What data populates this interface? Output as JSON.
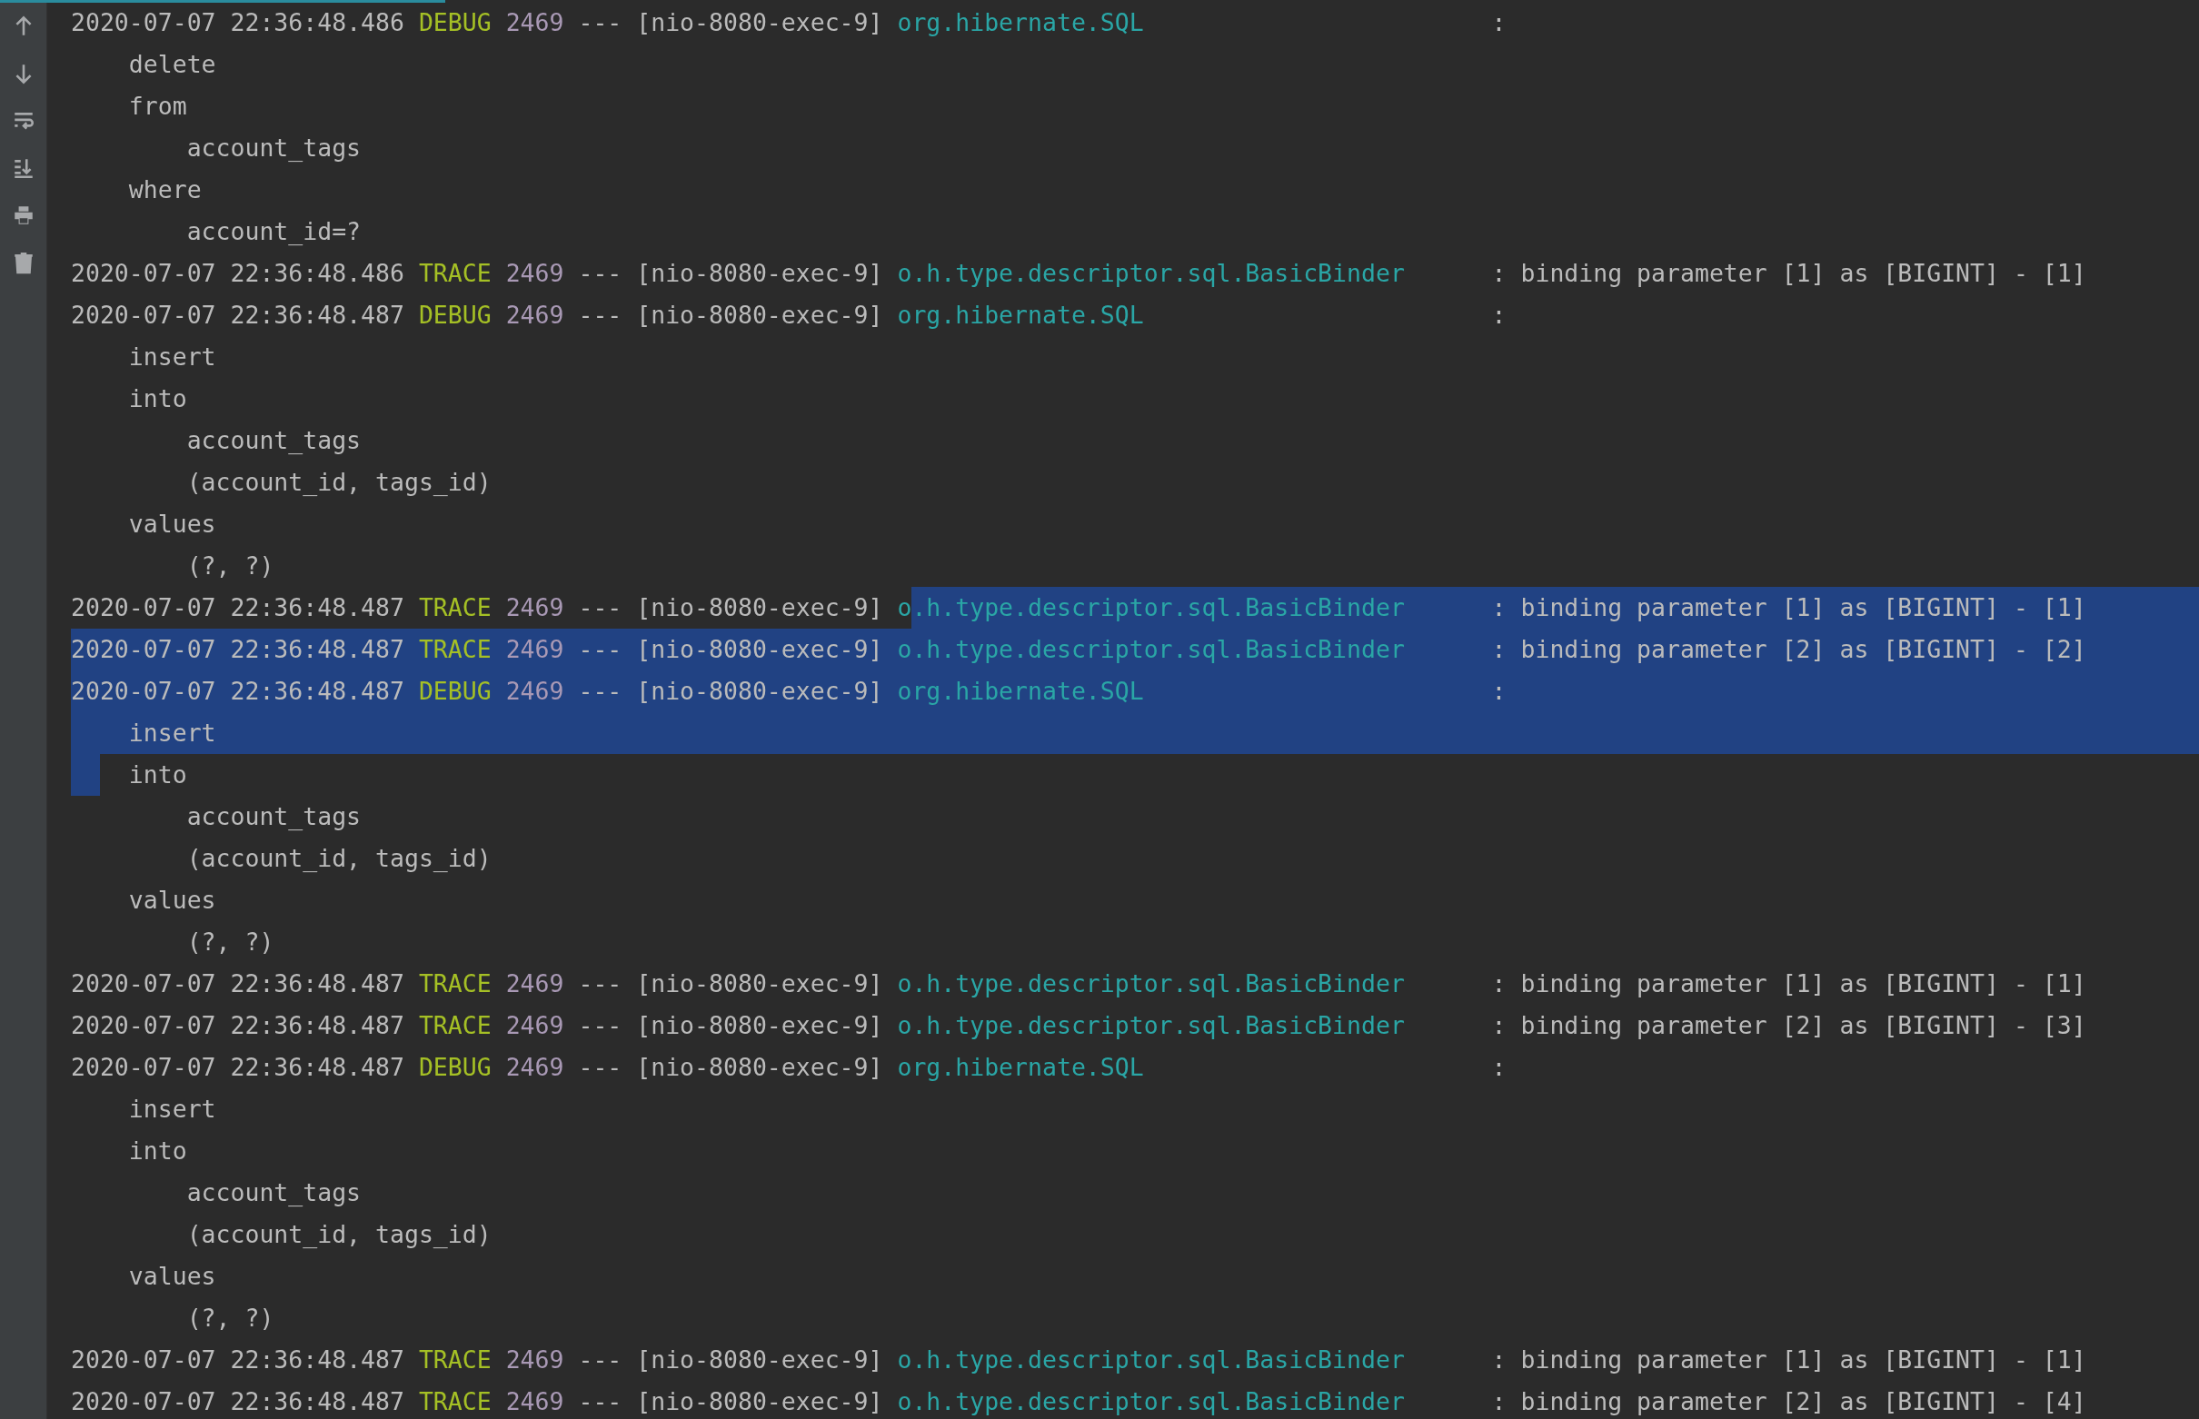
{
  "toolbar": {
    "buttons": [
      {
        "kind": "up"
      },
      {
        "kind": "down"
      },
      {
        "kind": "wrap"
      },
      {
        "kind": "scroll_end"
      },
      {
        "kind": "print"
      },
      {
        "kind": "trash"
      }
    ]
  },
  "lines": [
    {
      "kind": "log",
      "timestamp": "2020-07-07 22:36:48.486",
      "level": "DEBUG",
      "pid": "2469",
      "separator": "---",
      "thread": "[nio-8080-exec-9]",
      "logger": "org.hibernate.SQL",
      "message": ":",
      "selected": false,
      "selection_start": false,
      "selection_end": false
    },
    {
      "kind": "clause",
      "text": "delete",
      "selected": false,
      "selection_start": false,
      "selection_end": false
    },
    {
      "kind": "clause",
      "text": "from",
      "selected": false,
      "selection_start": false,
      "selection_end": false
    },
    {
      "kind": "arg",
      "text": "account_tags",
      "selected": false,
      "selection_start": false,
      "selection_end": false
    },
    {
      "kind": "clause",
      "text": "where",
      "selected": false,
      "selection_start": false,
      "selection_end": false
    },
    {
      "kind": "arg",
      "text": "account_id=?",
      "selected": false,
      "selection_start": false,
      "selection_end": false
    },
    {
      "kind": "log",
      "timestamp": "2020-07-07 22:36:48.486",
      "level": "TRACE",
      "pid": "2469",
      "separator": "---",
      "thread": "[nio-8080-exec-9]",
      "logger": "o.h.type.descriptor.sql.BasicBinder",
      "message": ": binding parameter [1] as [BIGINT] - [1]",
      "selected": false,
      "selection_start": false,
      "selection_end": false
    },
    {
      "kind": "log",
      "timestamp": "2020-07-07 22:36:48.487",
      "level": "DEBUG",
      "pid": "2469",
      "separator": "---",
      "thread": "[nio-8080-exec-9]",
      "logger": "org.hibernate.SQL",
      "message": ":",
      "selected": false,
      "selection_start": false,
      "selection_end": false
    },
    {
      "kind": "clause",
      "text": "insert",
      "selected": false,
      "selection_start": false,
      "selection_end": false
    },
    {
      "kind": "clause",
      "text": "into",
      "selected": false,
      "selection_start": false,
      "selection_end": false
    },
    {
      "kind": "arg",
      "text": "account_tags",
      "selected": false,
      "selection_start": false,
      "selection_end": false
    },
    {
      "kind": "arg",
      "text": "(account_id, tags_id)",
      "selected": false,
      "selection_start": false,
      "selection_end": false
    },
    {
      "kind": "clause",
      "text": "values",
      "selected": false,
      "selection_start": false,
      "selection_end": false
    },
    {
      "kind": "arg",
      "text": "(?, ?)",
      "selected": false,
      "selection_start": false,
      "selection_end": false
    },
    {
      "kind": "log",
      "timestamp": "2020-07-07 22:36:48.487",
      "level": "TRACE",
      "pid": "2469",
      "separator": "---",
      "thread": "[nio-8080-exec-9]",
      "logger": "o.h.type.descriptor.sql.BasicBinder",
      "message": ": binding parameter [1] as [BIGINT] - [1]",
      "selected": false,
      "selection_start": true,
      "selection_end": false
    },
    {
      "kind": "log",
      "timestamp": "2020-07-07 22:36:48.487",
      "level": "TRACE",
      "pid": "2469",
      "separator": "---",
      "thread": "[nio-8080-exec-9]",
      "logger": "o.h.type.descriptor.sql.BasicBinder",
      "message": ": binding parameter [2] as [BIGINT] - [2]",
      "selected": true,
      "selection_start": false,
      "selection_end": false
    },
    {
      "kind": "log",
      "timestamp": "2020-07-07 22:36:48.487",
      "level": "DEBUG",
      "pid": "2469",
      "separator": "---",
      "thread": "[nio-8080-exec-9]",
      "logger": "org.hibernate.SQL",
      "message": ":",
      "selected": true,
      "selection_start": false,
      "selection_end": false
    },
    {
      "kind": "clause",
      "text": "insert",
      "selected": true,
      "selection_start": false,
      "selection_end": false
    },
    {
      "kind": "clause",
      "text": "into",
      "selected": false,
      "selection_start": false,
      "selection_end": true
    },
    {
      "kind": "arg",
      "text": "account_tags",
      "selected": false,
      "selection_start": false,
      "selection_end": false
    },
    {
      "kind": "arg",
      "text": "(account_id, tags_id)",
      "selected": false,
      "selection_start": false,
      "selection_end": false
    },
    {
      "kind": "clause",
      "text": "values",
      "selected": false,
      "selection_start": false,
      "selection_end": false
    },
    {
      "kind": "arg",
      "text": "(?, ?)",
      "selected": false,
      "selection_start": false,
      "selection_end": false
    },
    {
      "kind": "log",
      "timestamp": "2020-07-07 22:36:48.487",
      "level": "TRACE",
      "pid": "2469",
      "separator": "---",
      "thread": "[nio-8080-exec-9]",
      "logger": "o.h.type.descriptor.sql.BasicBinder",
      "message": ": binding parameter [1] as [BIGINT] - [1]",
      "selected": false,
      "selection_start": false,
      "selection_end": false
    },
    {
      "kind": "log",
      "timestamp": "2020-07-07 22:36:48.487",
      "level": "TRACE",
      "pid": "2469",
      "separator": "---",
      "thread": "[nio-8080-exec-9]",
      "logger": "o.h.type.descriptor.sql.BasicBinder",
      "message": ": binding parameter [2] as [BIGINT] - [3]",
      "selected": false,
      "selection_start": false,
      "selection_end": false
    },
    {
      "kind": "log",
      "timestamp": "2020-07-07 22:36:48.487",
      "level": "DEBUG",
      "pid": "2469",
      "separator": "---",
      "thread": "[nio-8080-exec-9]",
      "logger": "org.hibernate.SQL",
      "message": ":",
      "selected": false,
      "selection_start": false,
      "selection_end": false
    },
    {
      "kind": "clause",
      "text": "insert",
      "selected": false,
      "selection_start": false,
      "selection_end": false
    },
    {
      "kind": "clause",
      "text": "into",
      "selected": false,
      "selection_start": false,
      "selection_end": false
    },
    {
      "kind": "arg",
      "text": "account_tags",
      "selected": false,
      "selection_start": false,
      "selection_end": false
    },
    {
      "kind": "arg",
      "text": "(account_id, tags_id)",
      "selected": false,
      "selection_start": false,
      "selection_end": false
    },
    {
      "kind": "clause",
      "text": "values",
      "selected": false,
      "selection_start": false,
      "selection_end": false
    },
    {
      "kind": "arg",
      "text": "(?, ?)",
      "selected": false,
      "selection_start": false,
      "selection_end": false
    },
    {
      "kind": "log",
      "timestamp": "2020-07-07 22:36:48.487",
      "level": "TRACE",
      "pid": "2469",
      "separator": "---",
      "thread": "[nio-8080-exec-9]",
      "logger": "o.h.type.descriptor.sql.BasicBinder",
      "message": ": binding parameter [1] as [BIGINT] - [1]",
      "selected": false,
      "selection_start": false,
      "selection_end": false
    },
    {
      "kind": "log",
      "timestamp": "2020-07-07 22:36:48.487",
      "level": "TRACE",
      "pid": "2469",
      "separator": "---",
      "thread": "[nio-8080-exec-9]",
      "logger": "o.h.type.descriptor.sql.BasicBinder",
      "message": ": binding parameter [2] as [BIGINT] - [4]",
      "selected": false,
      "selection_start": false,
      "selection_end": false
    }
  ]
}
